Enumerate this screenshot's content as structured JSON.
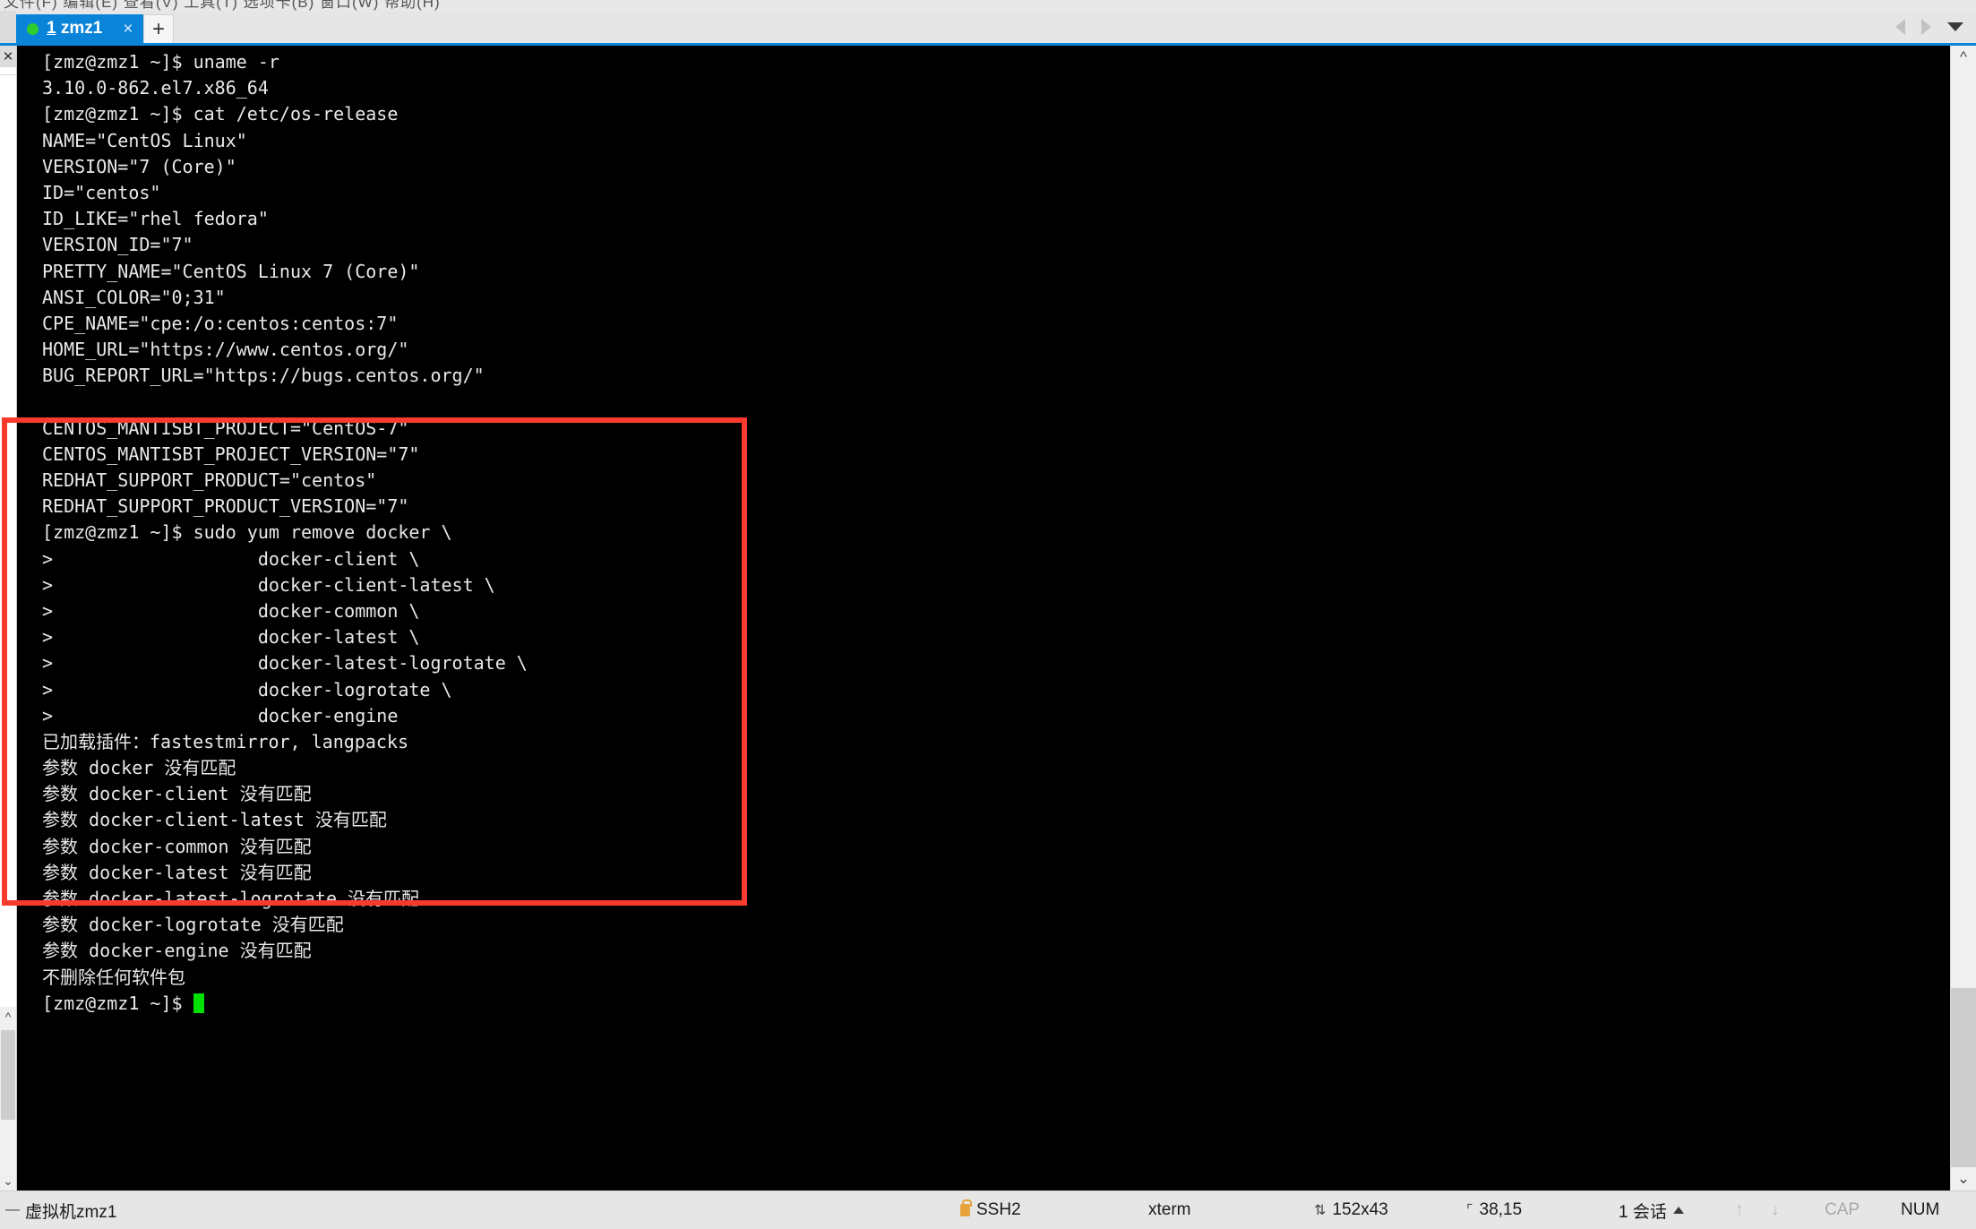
{
  "window": {
    "menu_strip_text": "文件(F) 编辑(E) 查看(V) 工具(T) 选项卡(B) 窗口(W) 帮助(H)"
  },
  "tabbar": {
    "close_all_icon": "close-icon",
    "tab": {
      "number": "1",
      "title": "zmz1",
      "full_label": "1 zmz1",
      "status_dot_color": "#2ecc2e",
      "close_label": "×"
    },
    "new_tab_label": "+",
    "nav_prev_icon": "triangle-left-icon",
    "nav_next_icon": "triangle-right-icon",
    "nav_dropdown_icon": "chevron-down-icon"
  },
  "leftpanel": {
    "search_icon": "magnifier-icon",
    "close_icon": "close-icon"
  },
  "terminal": {
    "lines": [
      "[zmz@zmz1 ~]$ uname -r",
      "3.10.0-862.el7.x86_64",
      "[zmz@zmz1 ~]$ cat /etc/os-release",
      "NAME=\"CentOS Linux\"",
      "VERSION=\"7 (Core)\"",
      "ID=\"centos\"",
      "ID_LIKE=\"rhel fedora\"",
      "VERSION_ID=\"7\"",
      "PRETTY_NAME=\"CentOS Linux 7 (Core)\"",
      "ANSI_COLOR=\"0;31\"",
      "CPE_NAME=\"cpe:/o:centos:centos:7\"",
      "HOME_URL=\"https://www.centos.org/\"",
      "BUG_REPORT_URL=\"https://bugs.centos.org/\"",
      "",
      "CENTOS_MANTISBT_PROJECT=\"CentOS-7\"",
      "CENTOS_MANTISBT_PROJECT_VERSION=\"7\"",
      "REDHAT_SUPPORT_PRODUCT=\"centos\"",
      "REDHAT_SUPPORT_PRODUCT_VERSION=\"7\"",
      "[zmz@zmz1 ~]$ sudo yum remove docker \\",
      ">                   docker-client \\",
      ">                   docker-client-latest \\",
      ">                   docker-common \\",
      ">                   docker-latest \\",
      ">                   docker-latest-logrotate \\",
      ">                   docker-logrotate \\",
      ">                   docker-engine",
      "已加载插件：fastestmirror, langpacks",
      "参数 docker 没有匹配",
      "参数 docker-client 没有匹配",
      "参数 docker-client-latest 没有匹配",
      "参数 docker-common 没有匹配",
      "参数 docker-latest 没有匹配",
      "参数 docker-latest-logrotate 没有匹配",
      "参数 docker-logrotate 没有匹配",
      "参数 docker-engine 没有匹配",
      "不删除任何软件包"
    ],
    "prompt_line": "[zmz@zmz1 ~]$ ",
    "cursor_color": "#00e000",
    "background": "#000000",
    "foreground": "#e8e8e8"
  },
  "annotation": {
    "highlight_color": "#f93a2f",
    "label": "red-highlight-box"
  },
  "statusbar": {
    "session_name": "虚拟机zmz1",
    "protocol": "SSH2",
    "terminal_type": "xterm",
    "dimensions": "152x43",
    "cursor_position": "38,15",
    "sessions": "1 会话",
    "cap_indicator": "CAP",
    "num_indicator": "NUM",
    "lock_icon": "lock-icon",
    "resize_icon": "resize-icon",
    "cursor_icon": "cursor-position-icon",
    "caret_icon": "caret-up-icon",
    "upload_icon": "arrow-up-icon",
    "download_icon": "arrow-down-icon"
  }
}
